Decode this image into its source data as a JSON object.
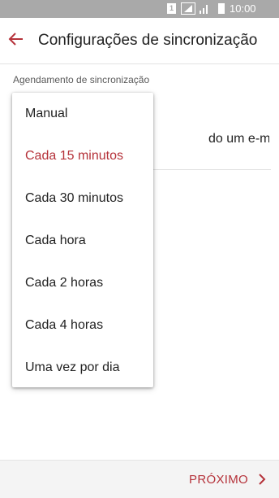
{
  "status_bar": {
    "sim_slot": "1",
    "time": "10:00"
  },
  "header": {
    "title": "Configurações de sincronização",
    "back_icon": "arrow-left-icon"
  },
  "schedule": {
    "section_label": "Agendamento de sincronização",
    "background_option_partial": "do um e-mail for"
  },
  "dropdown": {
    "options": [
      {
        "label": "Manual",
        "selected": false
      },
      {
        "label": "Cada 15 minutos",
        "selected": true
      },
      {
        "label": "Cada 30 minutos",
        "selected": false
      },
      {
        "label": "Cada hora",
        "selected": false
      },
      {
        "label": "Cada 2 horas",
        "selected": false
      },
      {
        "label": "Cada 4 horas",
        "selected": false
      },
      {
        "label": "Uma vez por dia",
        "selected": false
      }
    ]
  },
  "footer": {
    "next_label": "PRÓXIMO",
    "next_icon": "chevron-right-icon"
  },
  "colors": {
    "accent": "#b5323a",
    "status_bar": "#a9a9a9",
    "footer_bg": "#f4f4f4"
  }
}
